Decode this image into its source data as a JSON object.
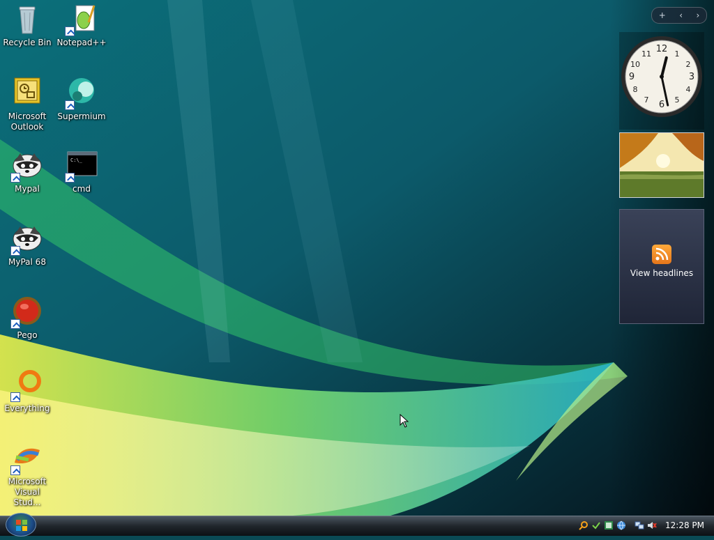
{
  "desktop_icons": [
    {
      "id": "recycle",
      "label": "Recycle Bin",
      "icon": "recycle-bin-icon"
    },
    {
      "id": "notepadpp",
      "label": "Notepad++",
      "icon": "notepad-plus-plus-icon"
    },
    {
      "id": "outlook",
      "label": "Microsoft Outlook",
      "icon": "outlook-icon"
    },
    {
      "id": "supermium",
      "label": "Supermium",
      "icon": "supermium-icon"
    },
    {
      "id": "mypal",
      "label": "Mypal",
      "icon": "mypal-icon"
    },
    {
      "id": "cmd",
      "label": "cmd",
      "icon": "cmd-icon"
    },
    {
      "id": "mypal68",
      "label": "MyPal 68",
      "icon": "mypal-icon"
    },
    {
      "id": "pego",
      "label": "Pego",
      "icon": "pego-icon"
    },
    {
      "id": "everything",
      "label": "Everything",
      "icon": "everything-icon"
    },
    {
      "id": "vstudio",
      "label": "Microsoft Visual Stud...",
      "icon": "visual-studio-icon"
    }
  ],
  "sidebar": {
    "controls": {
      "add": "+",
      "prev": "‹",
      "next": "›"
    },
    "clock": {
      "hour": 12,
      "minute": 28
    },
    "feed": {
      "label": "View headlines"
    }
  },
  "taskbar": {
    "time": "12:28 PM"
  },
  "colors": {
    "accent_feed": "#f08a24",
    "taskbar_dark": "#0c1014"
  }
}
